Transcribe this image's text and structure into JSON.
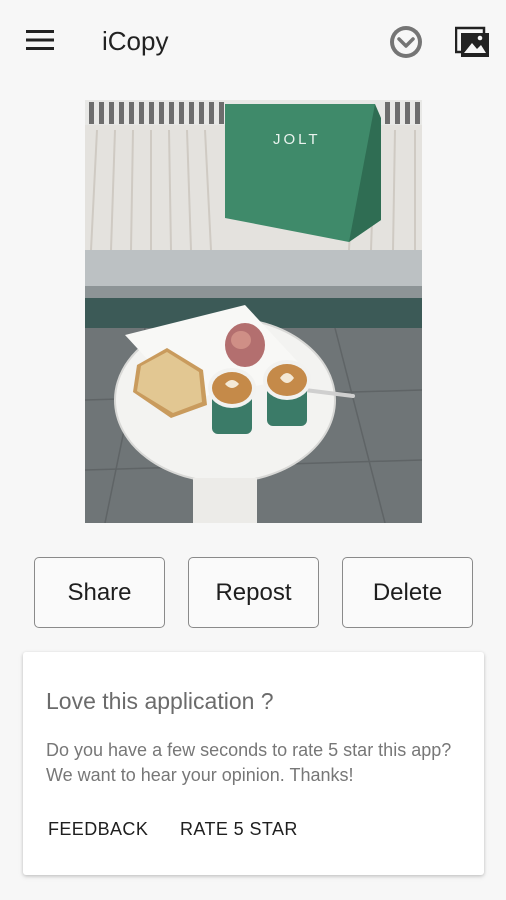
{
  "app_bar": {
    "title": "iCopy",
    "menu_icon": "hamburger-menu-icon",
    "dropdown_icon": "chevron-down-circle-icon",
    "gallery_icon": "image-gallery-icon"
  },
  "photo": {
    "subject": "coffee-table-photo"
  },
  "actions": {
    "share_label": "Share",
    "repost_label": "Repost",
    "delete_label": "Delete"
  },
  "rating_card": {
    "title": "Love this application ?",
    "body": "Do you have a few seconds to rate 5 star this app? We want to hear your opinion. Thanks!",
    "feedback_label": "FEEDBACK",
    "rate_label": "RATE 5 STAR"
  },
  "colors": {
    "background": "#f7f7f7",
    "card": "#ffffff",
    "icon_grey": "#757575",
    "button_border": "#8a8a8a",
    "bag_green": "#3f8a6a"
  }
}
